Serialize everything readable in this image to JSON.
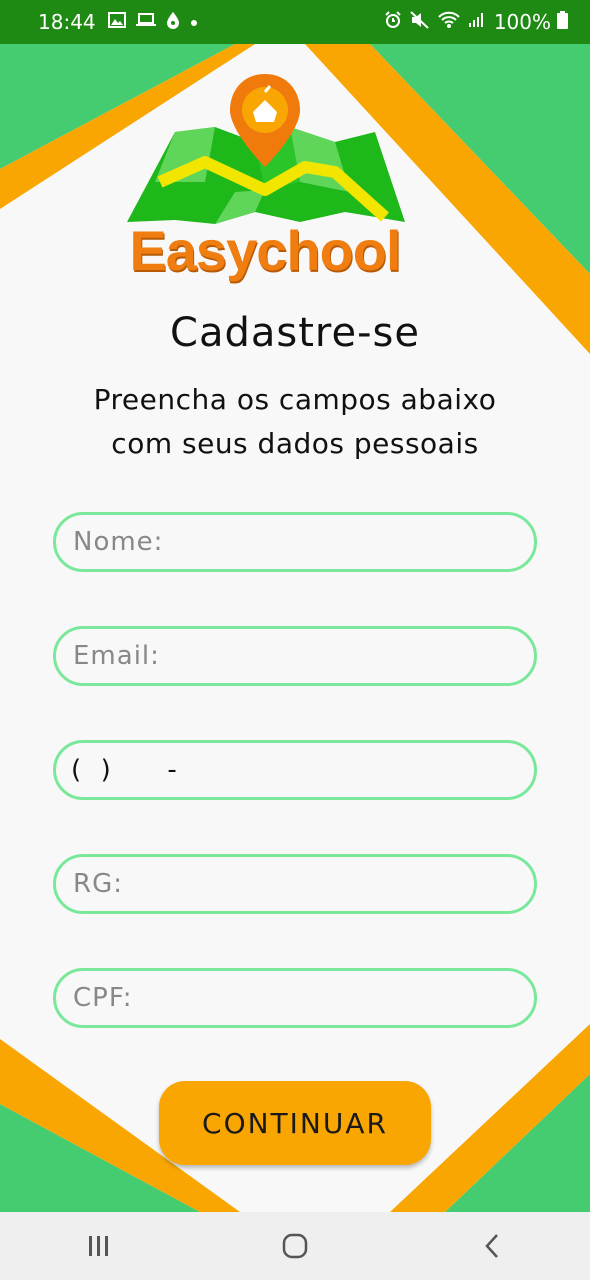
{
  "status_bar": {
    "time": "18:44",
    "battery": "100%",
    "icons_left": [
      "gallery-icon",
      "laptop-icon",
      "drop-icon",
      "dot-icon"
    ],
    "icons_right": [
      "alarm-icon",
      "mute-icon",
      "wifi-icon",
      "signal-icon",
      "battery-icon"
    ]
  },
  "logo": {
    "text": "Easychool"
  },
  "form": {
    "title": "Cadastre-se",
    "subtitle_line1": "Preencha os campos abaixo",
    "subtitle_line2": "com seus dados pessoais",
    "name_placeholder": "Nome:",
    "email_placeholder": "Email:",
    "phone_mask": "(  )      -",
    "rg_placeholder": "RG:",
    "cpf_placeholder": "CPF:",
    "continue_label": "CONTINUAR"
  },
  "colors": {
    "status_bar": "#1f8a13",
    "green": "#45cc71",
    "orange": "#f9a602",
    "field_border": "#7ae89a",
    "logo_orange": "#ef7d10"
  }
}
